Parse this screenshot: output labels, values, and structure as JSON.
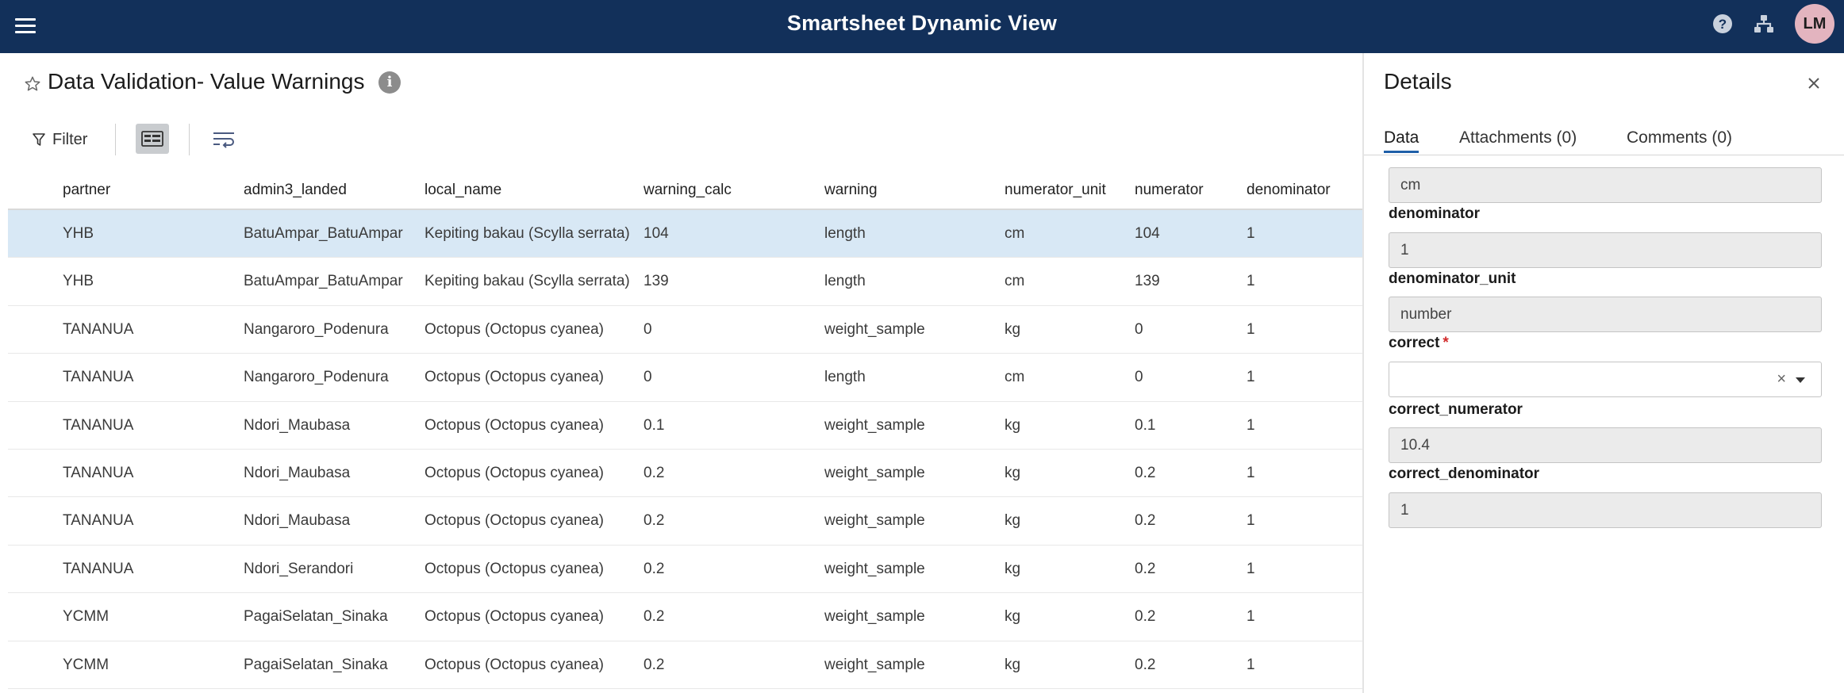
{
  "app": {
    "title": "Smartsheet Dynamic View",
    "avatar_initials": "LM",
    "header_color": "#12305a"
  },
  "view": {
    "title": "Data Validation- Value Warnings",
    "filter_label": "Filter"
  },
  "table": {
    "columns": [
      "partner",
      "admin3_landed",
      "local_name",
      "warning_calc",
      "warning",
      "numerator_unit",
      "numerator",
      "denominator"
    ],
    "rows": [
      [
        "YHB",
        "BatuAmpar_BatuAmpar",
        "Kepiting bakau (Scylla serrata)",
        "104",
        "length",
        "cm",
        "104",
        "1"
      ],
      [
        "YHB",
        "BatuAmpar_BatuAmpar",
        "Kepiting bakau (Scylla serrata)",
        "139",
        "length",
        "cm",
        "139",
        "1"
      ],
      [
        "TANANUA",
        "Nangaroro_Podenura",
        "Octopus (Octopus cyanea)",
        "0",
        "weight_sample",
        "kg",
        "0",
        "1"
      ],
      [
        "TANANUA",
        "Nangaroro_Podenura",
        "Octopus (Octopus cyanea)",
        "0",
        "length",
        "cm",
        "0",
        "1"
      ],
      [
        "TANANUA",
        "Ndori_Maubasa",
        "Octopus (Octopus cyanea)",
        "0.1",
        "weight_sample",
        "kg",
        "0.1",
        "1"
      ],
      [
        "TANANUA",
        "Ndori_Maubasa",
        "Octopus (Octopus cyanea)",
        "0.2",
        "weight_sample",
        "kg",
        "0.2",
        "1"
      ],
      [
        "TANANUA",
        "Ndori_Maubasa",
        "Octopus (Octopus cyanea)",
        "0.2",
        "weight_sample",
        "kg",
        "0.2",
        "1"
      ],
      [
        "TANANUA",
        "Ndori_Serandori",
        "Octopus (Octopus cyanea)",
        "0.2",
        "weight_sample",
        "kg",
        "0.2",
        "1"
      ],
      [
        "YCMM",
        "PagaiSelatan_Sinaka",
        "Octopus (Octopus cyanea)",
        "0.2",
        "weight_sample",
        "kg",
        "0.2",
        "1"
      ],
      [
        "YCMM",
        "PagaiSelatan_Sinaka",
        "Octopus (Octopus cyanea)",
        "0.2",
        "weight_sample",
        "kg",
        "0.2",
        "1"
      ]
    ],
    "selected_row_color": "#d8e8f5"
  },
  "details": {
    "title": "Details",
    "tabs": {
      "data": "Data",
      "attachments": "Attachments (0)",
      "comments": "Comments (0)"
    },
    "fields": {
      "top_value": "cm",
      "denominator_label": "denominator",
      "denominator_value": "1",
      "denominator_unit_label": "denominator_unit",
      "denominator_unit_value": "number",
      "correct_label": "correct",
      "correct_required": "*",
      "correct_value": "",
      "correct_clear": "×",
      "correct_numerator_label": "correct_numerator",
      "correct_numerator_value": "10.4",
      "correct_denominator_label": "correct_denominator",
      "correct_denominator_value": "1"
    }
  }
}
